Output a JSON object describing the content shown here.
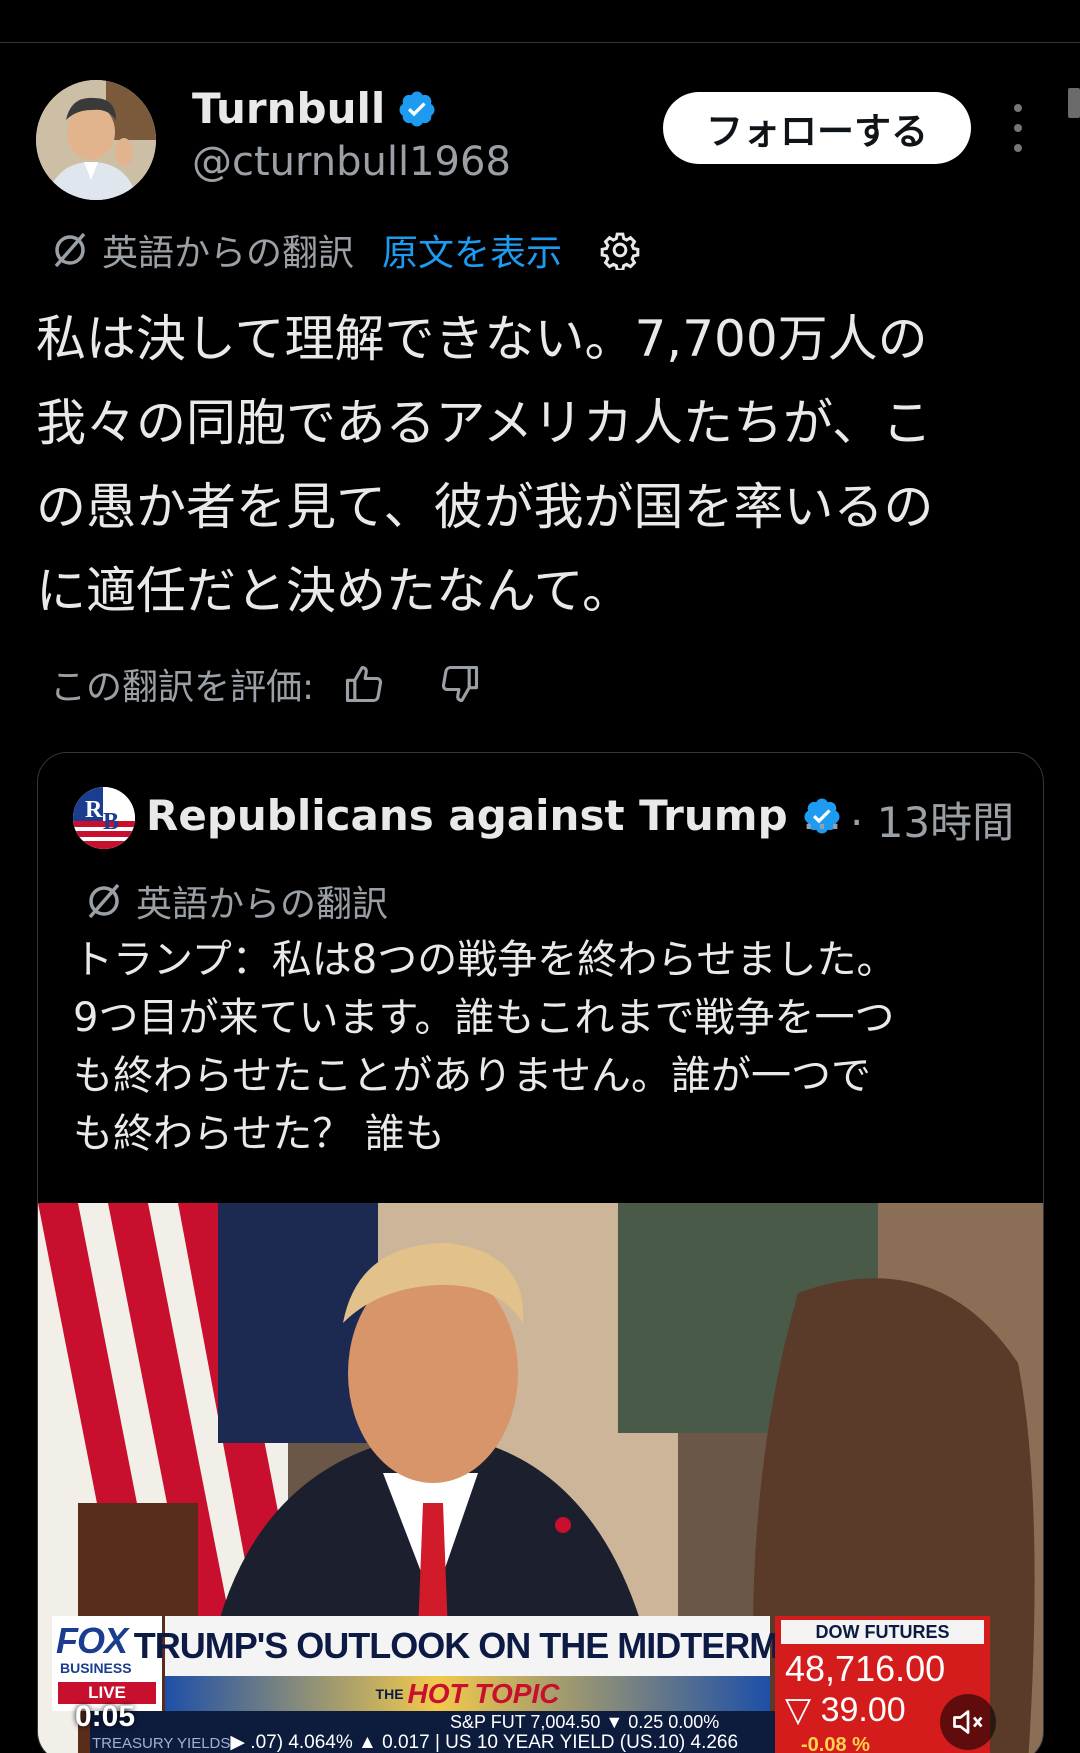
{
  "author": {
    "name": "Turnbull",
    "handle": "@cturnbull1968",
    "follow_label": "フォローする"
  },
  "translation": {
    "label": "英語からの翻訳",
    "show_original": "原文を表示"
  },
  "tweet": {
    "lines": [
      "私は決して理解できない。7,700万人の",
      "我々の同胞であるアメリカ人たちが、こ",
      "の愚か者を見て、彼が我が国を率いるの",
      "に適任だと決めたなんて。"
    ]
  },
  "rate": {
    "label": "この翻訳を評価:"
  },
  "quote": {
    "author": "Republicans against Trump",
    "ellipsis": "…",
    "time": "· 13時間",
    "translation_label": "英語からの翻訳",
    "lines": [
      "トランプ：私は8つの戦争を終わらせました。",
      "9つ目が来ています。誰もこれまで戦争を一つ",
      "も終わらせたことがありません。誰が一つで",
      "も終わらせた？ 誰も"
    ]
  },
  "video": {
    "timestamp": "0:05",
    "chyron": {
      "fox_logo": "FOX",
      "fox_sub": "BUSINESS",
      "live": "LIVE",
      "headline": "TRUMP'S OUTLOOK ON THE MIDTERMS",
      "hot_prefix": "THE",
      "hot_topic": "HOT TOPIC",
      "dow_label": "DOW FUTURES",
      "dow_value": "48,716.00",
      "dow_change": "39.00",
      "dow_pct": "-0.08 %",
      "ticker_row1": "S&P FUT    7,004.50  ▼ 0.25   0.00%",
      "ticker_label": "TREASURY YIELDS",
      "ticker_row2": ".07)  4.064%  ▲ 0.017  |  US 10 YEAR YIELD (US.10)  4.266"
    }
  },
  "colors": {
    "link": "#1d9bf0",
    "verified": "#1d9bf0",
    "muted_text": "#9aa0a6"
  }
}
